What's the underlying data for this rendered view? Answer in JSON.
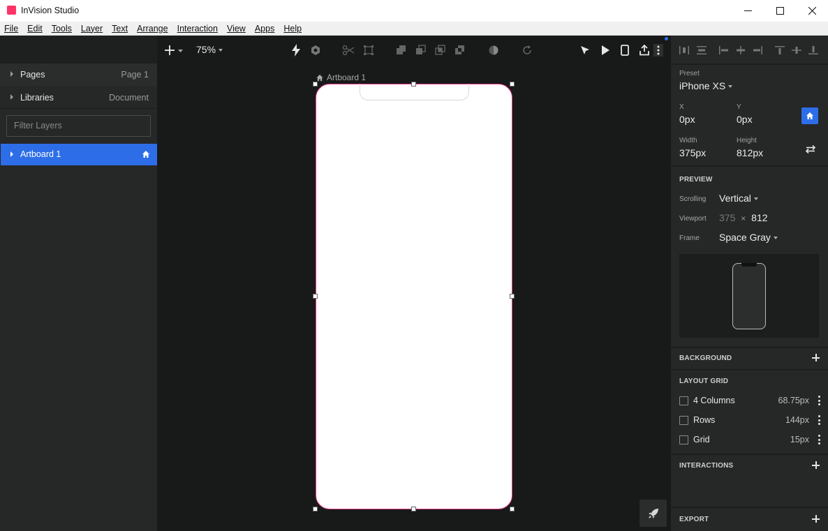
{
  "window": {
    "title": "InVision Studio",
    "accent": "#2d6ee8",
    "logo_color": "#ff3366"
  },
  "menu": [
    "File",
    "Edit",
    "Tools",
    "Layer",
    "Text",
    "Arrange",
    "Interaction",
    "View",
    "Apps",
    "Help"
  ],
  "left_panel": {
    "pages_label": "Pages",
    "pages_value": "Page 1",
    "libraries_label": "Libraries",
    "libraries_value": "Document",
    "filter_placeholder": "Filter Layers",
    "selected_layer": "Artboard 1"
  },
  "canvas": {
    "zoom": "75%",
    "artboard_label": "Artboard 1"
  },
  "right_panel": {
    "preset_label": "Preset",
    "preset_value": "iPhone XS",
    "x_label": "X",
    "x_value": "0px",
    "y_label": "Y",
    "y_value": "0px",
    "width_label": "Width",
    "width_value": "375px",
    "height_label": "Height",
    "height_value": "812px",
    "preview_title": "PREVIEW",
    "scrolling_label": "Scrolling",
    "scrolling_value": "Vertical",
    "viewport_label": "Viewport",
    "viewport_w": "375",
    "viewport_x": "×",
    "viewport_h": "812",
    "frame_label": "Frame",
    "frame_value": "Space Gray",
    "background_title": "BACKGROUND",
    "layout_grid_title": "LAYOUT GRID",
    "grid_rows": [
      {
        "label": "4 Columns",
        "value": "68.75px"
      },
      {
        "label": "Rows",
        "value": "144px"
      },
      {
        "label": "Grid",
        "value": "15px"
      }
    ],
    "interactions_title": "INTERACTIONS",
    "export_title": "EXPORT"
  }
}
